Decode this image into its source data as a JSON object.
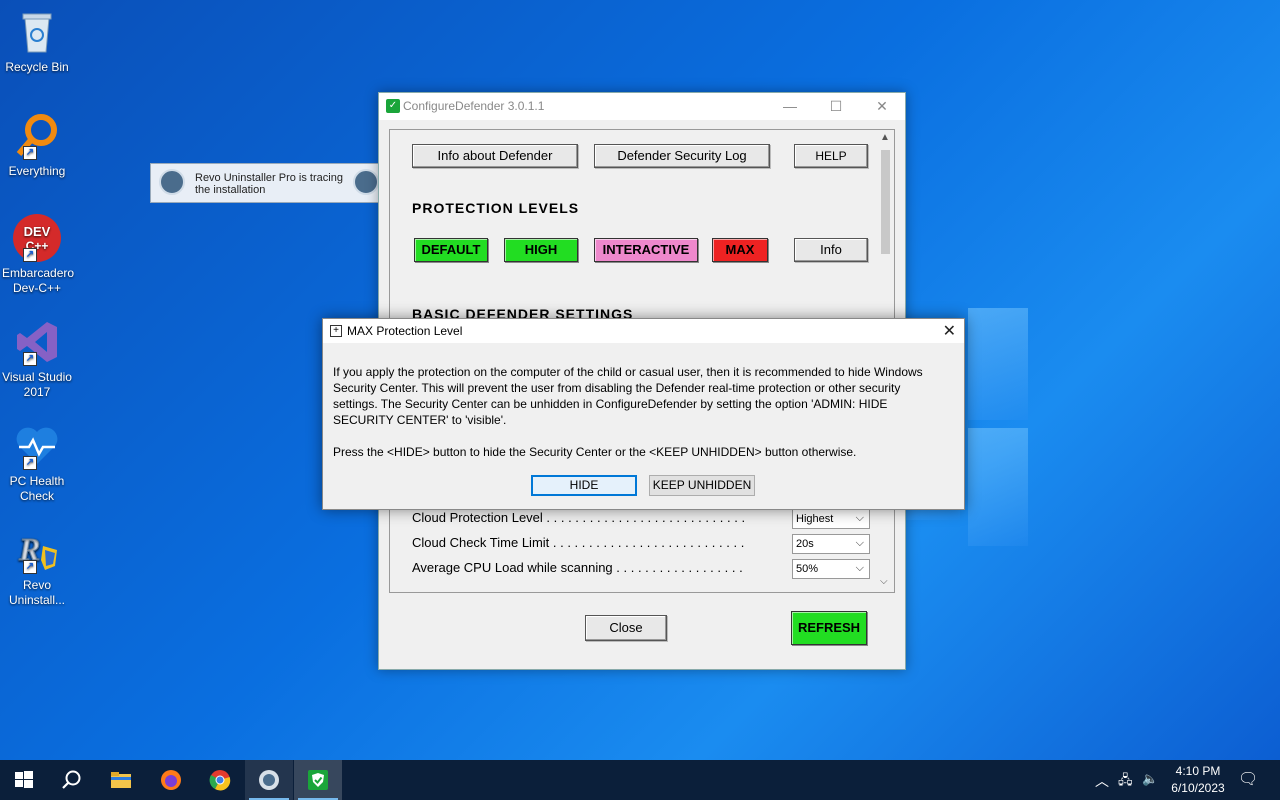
{
  "desktop": {
    "icons": [
      {
        "label": "Recycle Bin"
      },
      {
        "label": "Everything"
      },
      {
        "label": "Embarcadero Dev-C++"
      },
      {
        "label": "Visual Studio 2017"
      },
      {
        "label": "PC Health Check"
      },
      {
        "label": "Revo Uninstall..."
      }
    ]
  },
  "revo_tip": {
    "text": "Revo Uninstaller Pro is tracing the installation"
  },
  "main_window": {
    "title": "ConfigureDefender 3.0.1.1",
    "buttons": {
      "info_about": "Info about Defender",
      "security_log": "Defender Security Log",
      "help": "HELP"
    },
    "protection_levels_heading": "PROTECTION  LEVELS",
    "levels": {
      "default": "DEFAULT",
      "high": "HIGH",
      "interactive": "INTERACTIVE",
      "max": "MAX",
      "info": "Info"
    },
    "basic_settings_heading": "BASIC  DEFENDER  SETTINGS",
    "settings": [
      {
        "label": "Cloud Protection Level . . . . . . . . . . . . . . . . . . . . . . . . . . . .",
        "value": "Highest"
      },
      {
        "label": "Cloud Check Time Limit . . . . . . . . . . . . . . . . . . . . . . . . . . .",
        "value": "20s"
      },
      {
        "label": "Average CPU Load while scanning . . . . . . . . . . . . . . . . . .",
        "value": "50%"
      }
    ],
    "close_label": "Close",
    "refresh_label": "REFRESH"
  },
  "dialog": {
    "title": "MAX Protection Level",
    "paragraph1": "If you apply the protection on the computer of the child or casual user, then it is recommended to hide Windows Security Center. This will prevent the user from disabling the Defender real-time protection or other security settings. The Security Center can be unhidden in ConfigureDefender by setting the option 'ADMIN: HIDE SECURITY CENTER' to 'visible'.",
    "paragraph2": "Press the  <HIDE>  button to hide the Security Center or the  <KEEP  UNHIDDEN>  button otherwise.",
    "hide_label": "HIDE",
    "keep_label": "KEEP  UNHIDDEN"
  },
  "taskbar": {
    "time": "4:10 PM",
    "date": "6/10/2023"
  },
  "colors": {
    "level_green": "#22dd22",
    "level_pink": "#ee88cc",
    "level_red": "#ee2222",
    "refresh_green": "#22dd22"
  }
}
